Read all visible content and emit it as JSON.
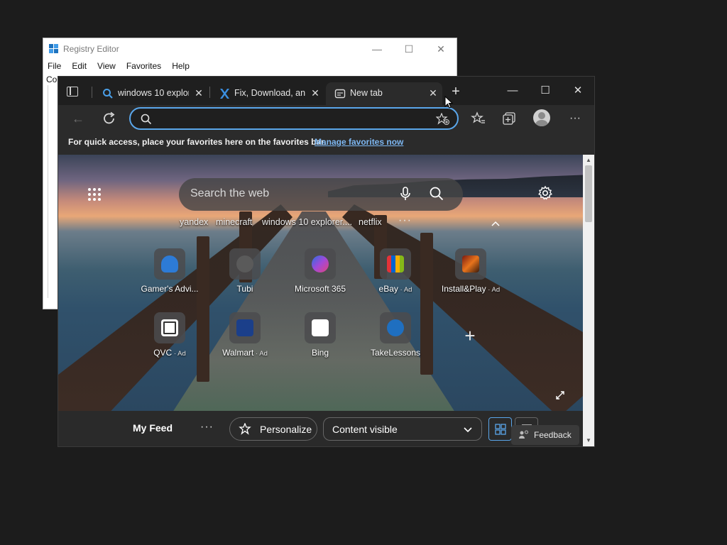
{
  "regedit": {
    "title": "Registry Editor",
    "menu": [
      "File",
      "Edit",
      "View",
      "Favorites",
      "Help"
    ],
    "address_partial": "Co"
  },
  "edge": {
    "tabs": [
      {
        "label": "windows 10 explor",
        "icon": "search-icon"
      },
      {
        "label": "Fix, Download, and",
        "icon": "x-logo-icon"
      },
      {
        "label": "New tab",
        "icon": "newtab-page-icon",
        "active": true
      }
    ],
    "address": {
      "value": "",
      "placeholder": ""
    },
    "favbar": {
      "message": "For quick access, place your favorites here on the favorites bar.",
      "link": "Manage favorites now"
    },
    "ntp": {
      "search_placeholder": "Search the web",
      "recent_searches": [
        "yandex",
        "minecraft",
        "windows 10 explorer....",
        "netflix"
      ],
      "more_symbol": "···",
      "tiles": [
        {
          "name": "Gamer's Advi...",
          "ad": ""
        },
        {
          "name": "Tubi",
          "ad": ""
        },
        {
          "name": "Microsoft 365",
          "ad": ""
        },
        {
          "name": "eBay",
          "ad": " · Ad"
        },
        {
          "name": "Install&Play",
          "ad": " · Ad"
        },
        {
          "name": "QVC",
          "ad": " · Ad"
        },
        {
          "name": "Walmart",
          "ad": " · Ad"
        },
        {
          "name": "Bing",
          "ad": ""
        },
        {
          "name": "TakeLessons",
          "ad": ""
        }
      ]
    },
    "feed": {
      "title": "My Feed",
      "personalize": "Personalize",
      "content_select": "Content visible",
      "feedback": "Feedback"
    }
  },
  "colors": {
    "accent": "#5aa6ea",
    "link": "#7db7f2"
  }
}
